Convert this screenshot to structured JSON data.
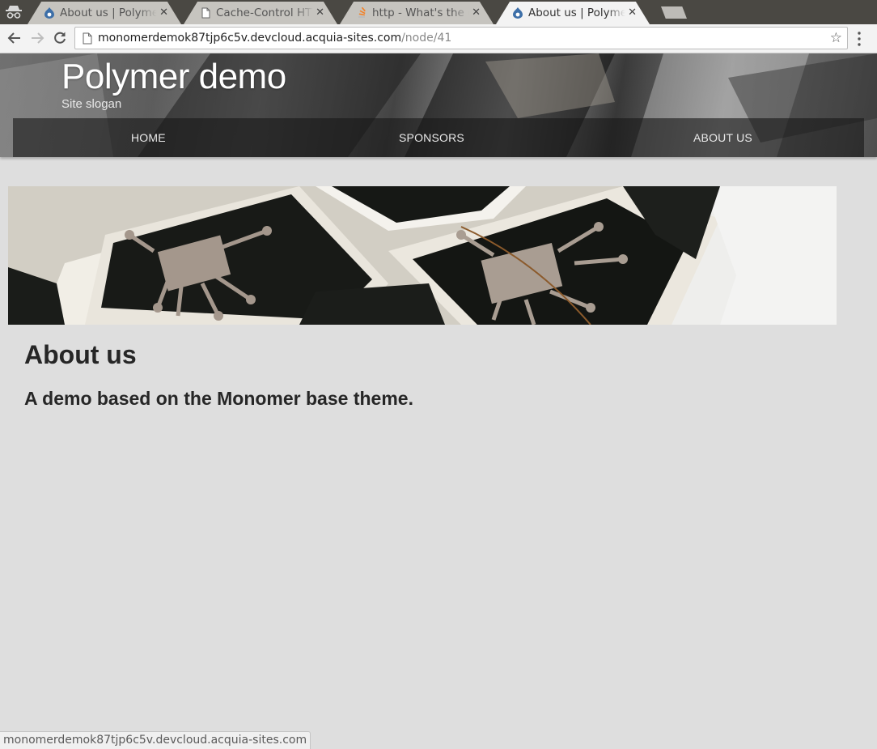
{
  "browser": {
    "tabs": [
      {
        "title": "About us | Polymer demo",
        "favicon": "drupal-icon",
        "active": false
      },
      {
        "title": "Cache-Control HTTP",
        "favicon": "page-icon",
        "active": false
      },
      {
        "title": "http - What's the difference",
        "favicon": "stackoverflow-icon",
        "active": false
      },
      {
        "title": "About us | Polymer demo",
        "favicon": "drupal-icon",
        "active": true
      }
    ],
    "close_glyph": "✕",
    "url_host": "monomerdemok87tjp6c5v.devcloud.acquia-sites.com",
    "url_path": "/node/41",
    "bookmark_glyph": "☆"
  },
  "site": {
    "name": "Polymer demo",
    "slogan": "Site slogan",
    "nav": [
      {
        "label": "Home"
      },
      {
        "label": "Sponsors"
      },
      {
        "label": "About us"
      }
    ]
  },
  "content": {
    "title": "About us",
    "heading": "A demo based on the Monomer base theme."
  },
  "status_bar": {
    "text": "monomerdemok87tjp6c5v.devcloud.acquia-sites.com"
  },
  "colors": {
    "page_bg": "#dedede",
    "tabstrip_bg": "#4a4843",
    "nav_overlay": "rgba(25,25,25,.62)",
    "heading_text": "#262626"
  }
}
